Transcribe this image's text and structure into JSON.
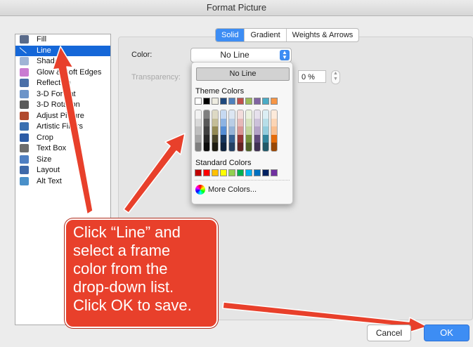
{
  "window": {
    "title": "Format Picture"
  },
  "sidebar": {
    "items": [
      {
        "label": "Fill",
        "icon": "paint-bucket-icon",
        "color": "#5a6b8a"
      },
      {
        "label": "Line",
        "icon": "line-icon",
        "color": "#ffffff",
        "selected": true
      },
      {
        "label": "Shadow",
        "icon": "shadow-icon",
        "color": "#9fb4d6"
      },
      {
        "label": "Glow & Soft Edges",
        "icon": "glow-icon",
        "color": "#c97bd1"
      },
      {
        "label": "Reflection",
        "icon": "reflection-icon",
        "color": "#4a6fa8"
      },
      {
        "label": "3-D Format",
        "icon": "3d-format-icon",
        "color": "#6c94c9"
      },
      {
        "label": "3-D Rotation",
        "icon": "3d-rotation-icon",
        "color": "#5a5a5a"
      },
      {
        "label": "Adjust Picture",
        "icon": "adjust-picture-icon",
        "color": "#b14a2e"
      },
      {
        "label": "Artistic Filters",
        "icon": "artistic-filters-icon",
        "color": "#3a6fb0"
      },
      {
        "label": "Crop",
        "icon": "crop-icon",
        "color": "#2d5ca6"
      },
      {
        "label": "Text Box",
        "icon": "text-box-icon",
        "color": "#6d6d6d"
      },
      {
        "label": "Size",
        "icon": "size-icon",
        "color": "#4f7fc2"
      },
      {
        "label": "Layout",
        "icon": "layout-icon",
        "color": "#3e69a9"
      },
      {
        "label": "Alt Text",
        "icon": "alt-text-icon",
        "color": "#4a90c9"
      }
    ]
  },
  "tabs": [
    {
      "label": "Solid",
      "selected": true
    },
    {
      "label": "Gradient"
    },
    {
      "label": "Weights & Arrows"
    }
  ],
  "form": {
    "color_label": "Color:",
    "color_value": "No Line",
    "transparency_label": "Transparency:",
    "transparency_value": "0 %"
  },
  "dropdown": {
    "no_line": "No Line",
    "theme_colors_label": "Theme Colors",
    "theme_colors": [
      "#ffffff",
      "#000000",
      "#eeece1",
      "#1f497d",
      "#4f81bd",
      "#c0504d",
      "#9bbb59",
      "#8064a2",
      "#4bacc6",
      "#f79646"
    ],
    "theme_shades": [
      [
        "#f2f2f2",
        "#d9d9d9",
        "#bfbfbf",
        "#a6a6a6",
        "#7f7f7f"
      ],
      [
        "#7f7f7f",
        "#595959",
        "#404040",
        "#262626",
        "#0d0d0d"
      ],
      [
        "#ddd9c4",
        "#c4bd97",
        "#948a54",
        "#4a452a",
        "#1e1c11"
      ],
      [
        "#c6d9f1",
        "#8db3e2",
        "#548dd4",
        "#17375e",
        "#0f243e"
      ],
      [
        "#dce6f2",
        "#b9cde5",
        "#95b3d7",
        "#366092",
        "#244062"
      ],
      [
        "#f2dcdb",
        "#e6b9b8",
        "#d99694",
        "#953735",
        "#632523"
      ],
      [
        "#ebf1de",
        "#d7e4bd",
        "#c3d69b",
        "#77933c",
        "#4f6228"
      ],
      [
        "#e6e0ec",
        "#ccc1da",
        "#b3a2c7",
        "#604a7b",
        "#403152"
      ],
      [
        "#dbeef4",
        "#b7dee8",
        "#93cddd",
        "#31859c",
        "#215968"
      ],
      [
        "#fdeada",
        "#fcd5b5",
        "#fac090",
        "#e46c0a",
        "#984807"
      ]
    ],
    "standard_colors_label": "Standard Colors",
    "standard_colors": [
      "#c00000",
      "#ff0000",
      "#ffc000",
      "#ffff00",
      "#92d050",
      "#00b050",
      "#00b0f0",
      "#0070c0",
      "#002060",
      "#7030a0"
    ],
    "more_colors": "More Colors..."
  },
  "callout": {
    "lines": [
      "Click “Line” and",
      "select a frame",
      "color from the",
      "drop-down list.",
      "Click OK to save."
    ],
    "color": "#e8402b"
  },
  "buttons": {
    "cancel": "Cancel",
    "ok": "OK"
  },
  "accent": "#3d8df4"
}
